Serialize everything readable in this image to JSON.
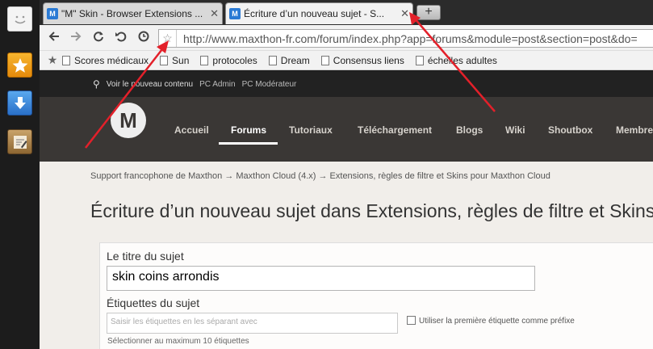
{
  "tabs": [
    {
      "favicon": "M",
      "title": "\"M\" Skin - Browser Extensions ...",
      "close": "✕"
    },
    {
      "favicon": "M",
      "title": "Écriture d’un nouveau sujet - S...",
      "close": "✕"
    }
  ],
  "new_tab_label": "+",
  "url": "http://www.maxthon-fr.com/forum/index.php?app=forums&module=post&section=post&do=",
  "bookmarks": [
    "Scores médicaux",
    "Sun",
    "protocoles",
    "Dream",
    "Consensus liens",
    "échelles adultes"
  ],
  "userbar": {
    "new_content": "Voir le nouveau contenu",
    "pc_admin": "PC Admin",
    "pc_mod": "PC Modérateur"
  },
  "logo_letter": "M",
  "main_nav": [
    "Accueil",
    "Forums",
    "Tutoriaux",
    "Téléchargement",
    "Blogs",
    "Wiki",
    "Shoutbox",
    "Membre"
  ],
  "breadcrumb": "Support francophone de Maxthon  →  Maxthon Cloud (4.x)  →  Extensions, règles de filtre et Skins pour Maxthon Cloud",
  "page_title": "Écriture d’un nouveau sujet dans Extensions, règles de filtre et Skins p",
  "form": {
    "title_label": "Le titre du sujet",
    "title_value": "skin coins arrondis",
    "tags_label": "Étiquettes du sujet",
    "tags_placeholder": "Saisir les étiquettes en les séparant avec",
    "prefix_label": "Utiliser la première étiquette comme préfixe",
    "tags_help": "Sélectionner au maximum 10 étiquettes"
  },
  "colors": {
    "annotation_arrow": "#e3202a",
    "tab_favicon": "#2a7ad4",
    "header_bg": "#3a3735"
  }
}
